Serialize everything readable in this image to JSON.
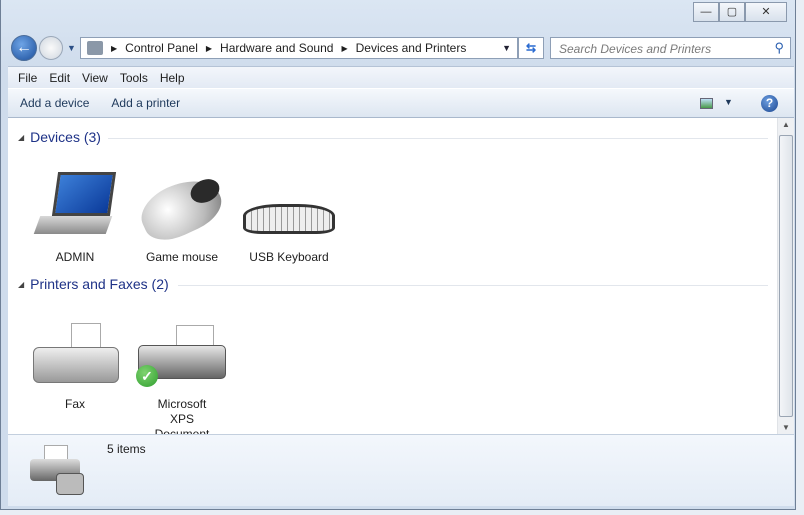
{
  "window": {
    "minimize": "—",
    "maximize": "▢",
    "close": "✕"
  },
  "address": {
    "crumbs": [
      "Control Panel",
      "Hardware and Sound",
      "Devices and Printers"
    ]
  },
  "search": {
    "placeholder": "Search Devices and Printers"
  },
  "menu": [
    "File",
    "Edit",
    "View",
    "Tools",
    "Help"
  ],
  "toolbar": {
    "add_device": "Add a device",
    "add_printer": "Add a printer"
  },
  "groups": {
    "devices": {
      "title": "Devices (3)",
      "items": [
        "ADMIN",
        "Game mouse",
        "USB Keyboard"
      ]
    },
    "printers": {
      "title": "Printers and Faxes (2)",
      "items": [
        "Fax",
        "Microsoft XPS Document Writer"
      ]
    }
  },
  "details": {
    "count": "5 items"
  },
  "colors": {
    "group_title": "#1e3287",
    "default_badge": "#2f9e2f"
  }
}
